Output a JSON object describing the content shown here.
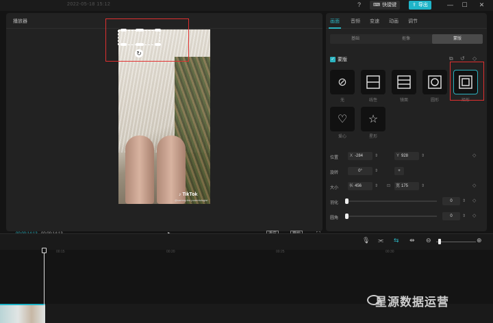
{
  "titlebar": {
    "date": "2022-05-18 15:12",
    "shortcut_label": "快捷键",
    "export_label": "导出",
    "icons": [
      "help-icon",
      "keyboard-icon",
      "export-icon",
      "minimize-icon",
      "maximize-icon",
      "close-icon"
    ]
  },
  "player": {
    "title": "播放器",
    "current_time": "00:00:14:13",
    "total_time": "00:00:14:13",
    "ratio_label": "适应",
    "original_label": "原始",
    "video": {
      "brand": "♪ TikTok",
      "handle": "@sammy.the.pudentologist"
    }
  },
  "props": {
    "tabs": [
      {
        "label": "画面",
        "active": true
      },
      {
        "label": "音频",
        "active": false
      },
      {
        "label": "变速",
        "active": false
      },
      {
        "label": "动画",
        "active": false
      },
      {
        "label": "调节",
        "active": false
      }
    ],
    "segments": [
      {
        "label": "基础",
        "active": false
      },
      {
        "label": "抠像",
        "active": false
      },
      {
        "label": "蒙版",
        "active": true
      }
    ],
    "mask_title": "蒙版",
    "masks": [
      {
        "label": "无",
        "icon": "none-icon",
        "selected": false
      },
      {
        "label": "线性",
        "icon": "linear-mask-icon",
        "selected": false
      },
      {
        "label": "镜面",
        "icon": "mirror-mask-icon",
        "selected": false
      },
      {
        "label": "圆形",
        "icon": "circle-mask-icon",
        "selected": false
      },
      {
        "label": "矩形",
        "icon": "rect-mask-icon",
        "selected": true
      },
      {
        "label": "爱心",
        "icon": "heart-mask-icon",
        "selected": false
      },
      {
        "label": "星形",
        "icon": "star-mask-icon",
        "selected": false
      }
    ],
    "position": {
      "label": "位置",
      "x_prefix": "X",
      "x": "-284",
      "y_prefix": "Y",
      "y": "928"
    },
    "rotation": {
      "label": "旋转",
      "value": "0°",
      "flip": "+"
    },
    "size": {
      "label": "大小",
      "h_prefix": "长",
      "h": "456",
      "w_prefix": "宽",
      "w": "175"
    },
    "feather": {
      "label": "羽化",
      "value": "0",
      "level": 0
    },
    "round": {
      "label": "圆角",
      "value": "0",
      "level": 0
    }
  },
  "timeline": {
    "ticks": [
      "00:15",
      "00:20",
      "00:25",
      "00:30"
    ],
    "zoom_level": 0.05
  },
  "watermark": "星源数据运营",
  "colors": {
    "accent": "#2bb3c0",
    "export": "#1fb5c9",
    "highlight": "#e03030"
  }
}
